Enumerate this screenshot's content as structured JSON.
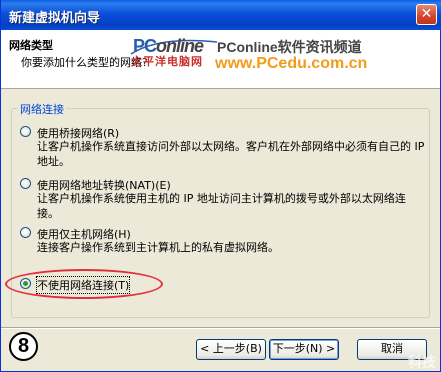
{
  "window": {
    "title": "新建虚拟机向导",
    "close_glyph": "✕"
  },
  "header": {
    "title": "网络类型",
    "subtitle": "你要添加什么类型的网络?"
  },
  "watermark": {
    "logo_pc": "PC",
    "logo_online": "online",
    "logo_cn": "太平洋电脑网",
    "site_name": "PConline软件资讯频道",
    "url": "www.PCedu.com.cn",
    "corner": "科技"
  },
  "group": {
    "legend": "网络连接",
    "options": [
      {
        "label": "使用桥接网络(R)",
        "desc": "让客户机操作系统直接访问外部以太网络。客户机在外部网络中必须有自己的 IP 地址。",
        "checked": false
      },
      {
        "label": "使用网络地址转换(NAT)(E)",
        "desc": "让客户机操作系统使用主机的 IP 地址访问主计算机的拨号或外部以太网络连接。",
        "checked": false
      },
      {
        "label": "使用仅主机网络(H)",
        "desc": "连接客户操作系统到主计算机上的私有虚拟网络。",
        "checked": false
      },
      {
        "label": "不使用网络连接(T)",
        "desc": "",
        "checked": true
      }
    ]
  },
  "step_badge": "8",
  "buttons": {
    "back": "< 上一步(B)",
    "next": "下一步(N) >",
    "cancel": "取消"
  },
  "colors": {
    "titlebar": "#0a4fd8",
    "legend": "#0046d5",
    "highlight_ellipse": "#e0313a",
    "watermark_url": "#f39b1a"
  }
}
